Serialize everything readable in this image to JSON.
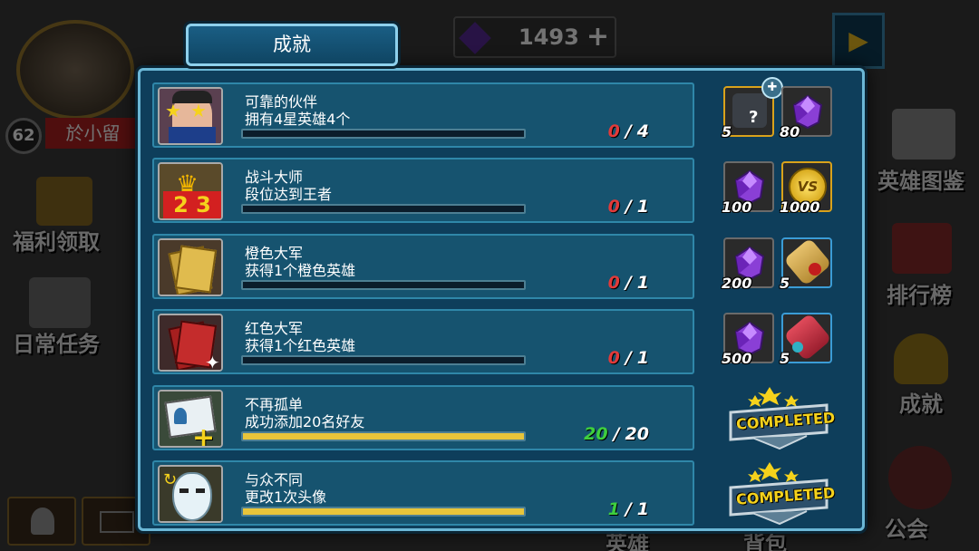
{
  "player": {
    "level": "62",
    "name": "於小留"
  },
  "top_bar": {
    "gem_count": "1493"
  },
  "left_menu": [
    "福利领取",
    "日常任务"
  ],
  "right_menu": [
    "英雄图鉴",
    "排行榜",
    "成就",
    "公会"
  ],
  "bottom_menu": [
    "英雄",
    "背包"
  ],
  "panel": {
    "title": "成就"
  },
  "achievements": [
    {
      "title": "可靠的伙伴",
      "desc": "拥有4星英雄4个",
      "current": "0",
      "total": "4",
      "sep": "/",
      "progress": 0,
      "completed": false,
      "rewards": [
        {
          "icon": "hero-shard-icon",
          "amount": "5"
        },
        {
          "icon": "purple-gem-icon",
          "amount": "80"
        }
      ]
    },
    {
      "title": "战斗大师",
      "desc": "段位达到王者",
      "current": "0",
      "total": "1",
      "sep": "/",
      "progress": 0,
      "completed": false,
      "rewards": [
        {
          "icon": "purple-gem-icon",
          "amount": "100"
        },
        {
          "icon": "vs-coin-icon",
          "amount": "1000"
        }
      ]
    },
    {
      "title": "橙色大军",
      "desc": "获得1个橙色英雄",
      "current": "0",
      "total": "1",
      "sep": "/",
      "progress": 0,
      "completed": false,
      "rewards": [
        {
          "icon": "purple-gem-icon",
          "amount": "200"
        },
        {
          "icon": "scroll-icon",
          "amount": "5"
        }
      ]
    },
    {
      "title": "红色大军",
      "desc": "获得1个红色英雄",
      "current": "0",
      "total": "1",
      "sep": "/",
      "progress": 0,
      "completed": false,
      "rewards": [
        {
          "icon": "purple-gem-icon",
          "amount": "500"
        },
        {
          "icon": "red-scroll-icon",
          "amount": "5"
        }
      ]
    },
    {
      "title": "不再孤单",
      "desc": "成功添加20名好友",
      "current": "20",
      "total": "20",
      "sep": "/",
      "progress": 1,
      "completed": true,
      "rewards": []
    },
    {
      "title": "与众不同",
      "desc": "更改1次头像",
      "current": "1",
      "total": "1",
      "sep": "/",
      "progress": 1,
      "completed": true,
      "rewards": []
    }
  ],
  "completed_label": "COMPLETED",
  "colors": {
    "panel": "#0e3e5b",
    "row": "#16536f",
    "bar_fill": "#e8c53a",
    "progress_red": "#e23a3a",
    "progress_green": "#3ecf3e"
  }
}
